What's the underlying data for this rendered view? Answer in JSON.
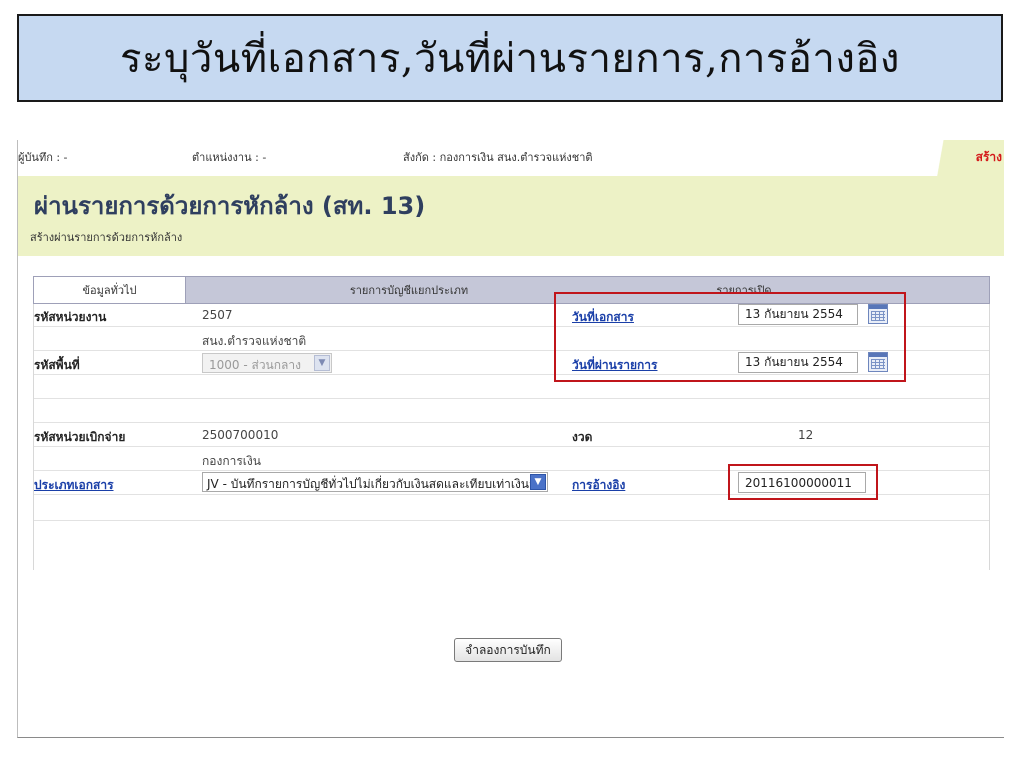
{
  "slide": {
    "title": "ระบุวันที่เอกสาร,วันที่ผ่านรายการ,การอ้างอิง"
  },
  "userbar": {
    "recorder": "ผู้บันทึก : -",
    "position": "ตำแหน่งงาน : -",
    "affiliation": "สังกัด : กองการเงิน สนง.ตำรวจแห่งชาติ",
    "create_tab": "สร้าง"
  },
  "page": {
    "title": "ผ่านรายการด้วยการหักล้าง (สท. 13)",
    "subtitle": "สร้างผ่านรายการด้วยการหักล้าง"
  },
  "tabs": [
    {
      "label": "ข้อมูลทั่วไป",
      "active": true
    },
    {
      "label": "รายการบัญชีแยกประเภท",
      "active": false
    },
    {
      "label": "รายการเปิด",
      "active": false
    }
  ],
  "form": {
    "agency_code": {
      "label": "รหัสหน่วยงาน",
      "value": "2507",
      "sub": "สนง.ตำรวจแห่งชาติ"
    },
    "area_code": {
      "label": "รหัสพื้นที่",
      "value": "1000 - ส่วนกลาง"
    },
    "disbursing_unit": {
      "label": "รหัสหน่วยเบิกจ่าย",
      "value": "2500700010",
      "sub": "กองการเงิน"
    },
    "document_type": {
      "label": "ประเภทเอกสาร",
      "value": "JV - บันทึกรายการบัญชีทั่วไปไม่เกี่ยวกับเงินสดและเทียบเท่าเงินสด"
    },
    "document_date": {
      "label": "วันที่เอกสาร",
      "value": "13 กันยายน 2554"
    },
    "posting_date": {
      "label": "วันที่ผ่านรายการ",
      "value": "13 กันยายน 2554"
    },
    "period": {
      "label": "งวด",
      "value": "12"
    },
    "reference": {
      "label": "การอ้างอิง",
      "value": "20116100000011"
    }
  },
  "actions": {
    "simulate_label": "จำลองการบันทึก"
  },
  "icons": {
    "calendar": "calendar-icon",
    "dropdown": "chevron-down-icon"
  },
  "colors": {
    "banner_bg": "#c6d9f1",
    "header_bg": "#edf2c6",
    "highlight": "#c0151b",
    "link": "#1a3fa8",
    "title": "#2f3f5f"
  }
}
